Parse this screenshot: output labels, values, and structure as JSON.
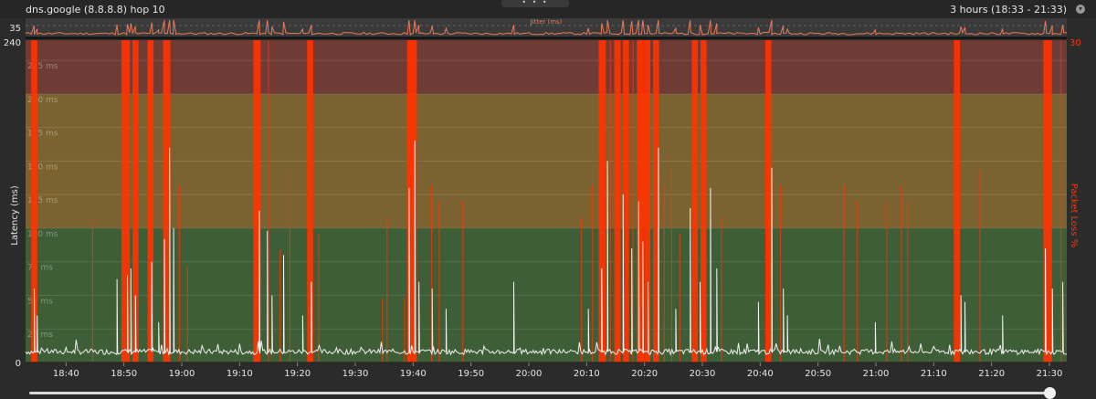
{
  "header": {
    "title": "dns.google (8.8.8.8) hop 10",
    "time_range": "3 hours (18:33 - 21:33)"
  },
  "jitter": {
    "label": "Jitter (ms)",
    "y_max_label": "35",
    "color": "#e87a5a"
  },
  "chart_data": {
    "type": "line",
    "title": "",
    "ylabel": "Latency (ms)",
    "y2label": "Packet Loss %",
    "y2_max_label": "30",
    "ylim": [
      0,
      240
    ],
    "y_ticks": [
      "0",
      "240"
    ],
    "inner_tick_labels": [
      "25 ms",
      "50 ms",
      "75 ms",
      "100 ms",
      "125 ms",
      "150 ms",
      "175 ms",
      "200 ms",
      "225 ms"
    ],
    "inner_tick_values": [
      25,
      50,
      75,
      100,
      125,
      150,
      175,
      200,
      225
    ],
    "x_tick_labels": [
      "18:40",
      "18:50",
      "19:00",
      "19:10",
      "19:20",
      "19:30",
      "19:40",
      "19:50",
      "20:00",
      "20:10",
      "20:20",
      "20:30",
      "20:40",
      "20:50",
      "21:00",
      "21:10",
      "21:20",
      "21:30"
    ],
    "x_tick_minutes": [
      7,
      17,
      27,
      37,
      47,
      57,
      67,
      77,
      87,
      97,
      107,
      117,
      127,
      137,
      147,
      157,
      167,
      177
    ],
    "x_range_minutes": [
      0,
      180
    ],
    "x_start": "18:33",
    "bands": [
      {
        "from": 0,
        "to": 100,
        "color": "#3d5e36"
      },
      {
        "from": 100,
        "to": 200,
        "color": "#7a6330"
      },
      {
        "from": 200,
        "to": 240,
        "color": "#6e3b35"
      }
    ],
    "latency_color": "#f2f2f2",
    "loss_color": "#ff3300",
    "baseline_ms": 8,
    "latency_spikes": [
      {
        "t": 1.5,
        "v": 55
      },
      {
        "t": 2.0,
        "v": 35
      },
      {
        "t": 15.8,
        "v": 62
      },
      {
        "t": 17.6,
        "v": 65
      },
      {
        "t": 18.2,
        "v": 70
      },
      {
        "t": 19.0,
        "v": 50
      },
      {
        "t": 21.8,
        "v": 75
      },
      {
        "t": 23.0,
        "v": 30
      },
      {
        "t": 24.0,
        "v": 92
      },
      {
        "t": 24.9,
        "v": 160
      },
      {
        "t": 25.6,
        "v": 100
      },
      {
        "t": 40.4,
        "v": 113
      },
      {
        "t": 41.8,
        "v": 98
      },
      {
        "t": 42.6,
        "v": 50
      },
      {
        "t": 44.6,
        "v": 80
      },
      {
        "t": 47.9,
        "v": 35
      },
      {
        "t": 49.4,
        "v": 60
      },
      {
        "t": 66.3,
        "v": 130
      },
      {
        "t": 67.3,
        "v": 165
      },
      {
        "t": 68.0,
        "v": 60
      },
      {
        "t": 70.3,
        "v": 55
      },
      {
        "t": 72.7,
        "v": 40
      },
      {
        "t": 84.4,
        "v": 60
      },
      {
        "t": 97.3,
        "v": 40
      },
      {
        "t": 99.6,
        "v": 70
      },
      {
        "t": 100.6,
        "v": 150
      },
      {
        "t": 103.3,
        "v": 125
      },
      {
        "t": 104.8,
        "v": 85
      },
      {
        "t": 106.0,
        "v": 120
      },
      {
        "t": 106.7,
        "v": 90
      },
      {
        "t": 107.6,
        "v": 60
      },
      {
        "t": 109.4,
        "v": 160
      },
      {
        "t": 112.4,
        "v": 40
      },
      {
        "t": 114.9,
        "v": 115
      },
      {
        "t": 116.6,
        "v": 60
      },
      {
        "t": 118.4,
        "v": 130
      },
      {
        "t": 119.5,
        "v": 70
      },
      {
        "t": 126.7,
        "v": 45
      },
      {
        "t": 129.0,
        "v": 145
      },
      {
        "t": 131.0,
        "v": 55
      },
      {
        "t": 131.7,
        "v": 35
      },
      {
        "t": 146.9,
        "v": 30
      },
      {
        "t": 161.7,
        "v": 50
      },
      {
        "t": 162.4,
        "v": 45
      },
      {
        "t": 168.9,
        "v": 35
      },
      {
        "t": 176.3,
        "v": 85
      },
      {
        "t": 177.5,
        "v": 55
      },
      {
        "t": 179.3,
        "v": 60
      }
    ],
    "packet_loss_thick": [
      {
        "t": 1.5,
        "w": 1.0
      },
      {
        "t": 17.3,
        "w": 1.4
      },
      {
        "t": 19.0,
        "w": 1.0
      },
      {
        "t": 21.6,
        "w": 1.0
      },
      {
        "t": 24.4,
        "w": 1.2
      },
      {
        "t": 40.0,
        "w": 1.2
      },
      {
        "t": 49.2,
        "w": 1.0
      },
      {
        "t": 66.8,
        "w": 1.6
      },
      {
        "t": 99.7,
        "w": 1.2
      },
      {
        "t": 102.3,
        "w": 1.0
      },
      {
        "t": 103.8,
        "w": 1.0
      },
      {
        "t": 106.3,
        "w": 1.2
      },
      {
        "t": 107.5,
        "w": 1.0
      },
      {
        "t": 109.0,
        "w": 1.0
      },
      {
        "t": 115.7,
        "w": 1.0
      },
      {
        "t": 117.2,
        "w": 1.0
      },
      {
        "t": 128.4,
        "w": 1.0
      },
      {
        "t": 161.0,
        "w": 1.0
      },
      {
        "t": 176.7,
        "w": 1.4
      }
    ],
    "packet_loss_thin": [
      {
        "t": 11.6,
        "h": 0.45
      },
      {
        "t": 26.6,
        "h": 0.55
      },
      {
        "t": 28.0,
        "h": 0.3
      },
      {
        "t": 42.0,
        "h": 1.0
      },
      {
        "t": 44.0,
        "h": 0.35
      },
      {
        "t": 45.7,
        "h": 0.6
      },
      {
        "t": 50.7,
        "h": 0.4
      },
      {
        "t": 61.7,
        "h": 0.2
      },
      {
        "t": 62.5,
        "h": 0.45
      },
      {
        "t": 65.5,
        "h": 0.2
      },
      {
        "t": 70.2,
        "h": 0.55
      },
      {
        "t": 71.5,
        "h": 0.5
      },
      {
        "t": 75.6,
        "h": 0.5
      },
      {
        "t": 96.1,
        "h": 0.45
      },
      {
        "t": 98.0,
        "h": 0.55
      },
      {
        "t": 101.1,
        "h": 1.0
      },
      {
        "t": 102.8,
        "h": 1.0
      },
      {
        "t": 105.0,
        "h": 1.0
      },
      {
        "t": 110.4,
        "h": 0.55
      },
      {
        "t": 111.7,
        "h": 0.6
      },
      {
        "t": 113.1,
        "h": 0.4
      },
      {
        "t": 120.3,
        "h": 0.45
      },
      {
        "t": 128.0,
        "h": 0.6
      },
      {
        "t": 130.5,
        "h": 0.55
      },
      {
        "t": 141.5,
        "h": 0.55
      },
      {
        "t": 143.8,
        "h": 0.5
      },
      {
        "t": 148.9,
        "h": 0.5
      },
      {
        "t": 151.4,
        "h": 0.55
      },
      {
        "t": 152.5,
        "h": 0.5
      },
      {
        "t": 165.0,
        "h": 0.6
      },
      {
        "t": 179.0,
        "h": 1.0
      }
    ]
  },
  "timeline": {
    "slider_position": 1.0
  }
}
